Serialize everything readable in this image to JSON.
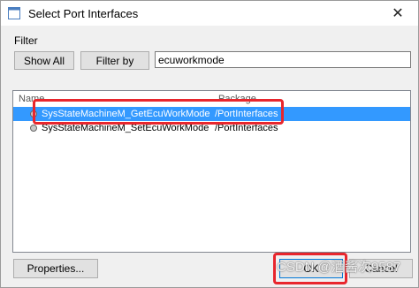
{
  "window": {
    "title": "Select Port Interfaces",
    "close_glyph": "✕",
    "icon": "dialog-icon"
  },
  "filter": {
    "label": "Filter",
    "show_all_label": "Show All",
    "filter_by_label": "Filter by",
    "input_value": "ecuworkmode"
  },
  "list": {
    "columns": [
      "Name",
      "Package"
    ],
    "rows": [
      {
        "name": "SysStateMachineM_GetEcuWorkMode",
        "package": "/PortInterfaces",
        "selected": true
      },
      {
        "name": "SysStateMachineM_SetEcuWorkMode",
        "package": "/PortInterfaces",
        "selected": false
      }
    ]
  },
  "footer": {
    "properties_label": "Properties...",
    "ok_label": "OK",
    "cancel_label": "Cancel"
  },
  "watermark": "CSDN @酒酱次9587",
  "colors": {
    "selection": "#3399ff",
    "annotation": "#e8262d"
  }
}
